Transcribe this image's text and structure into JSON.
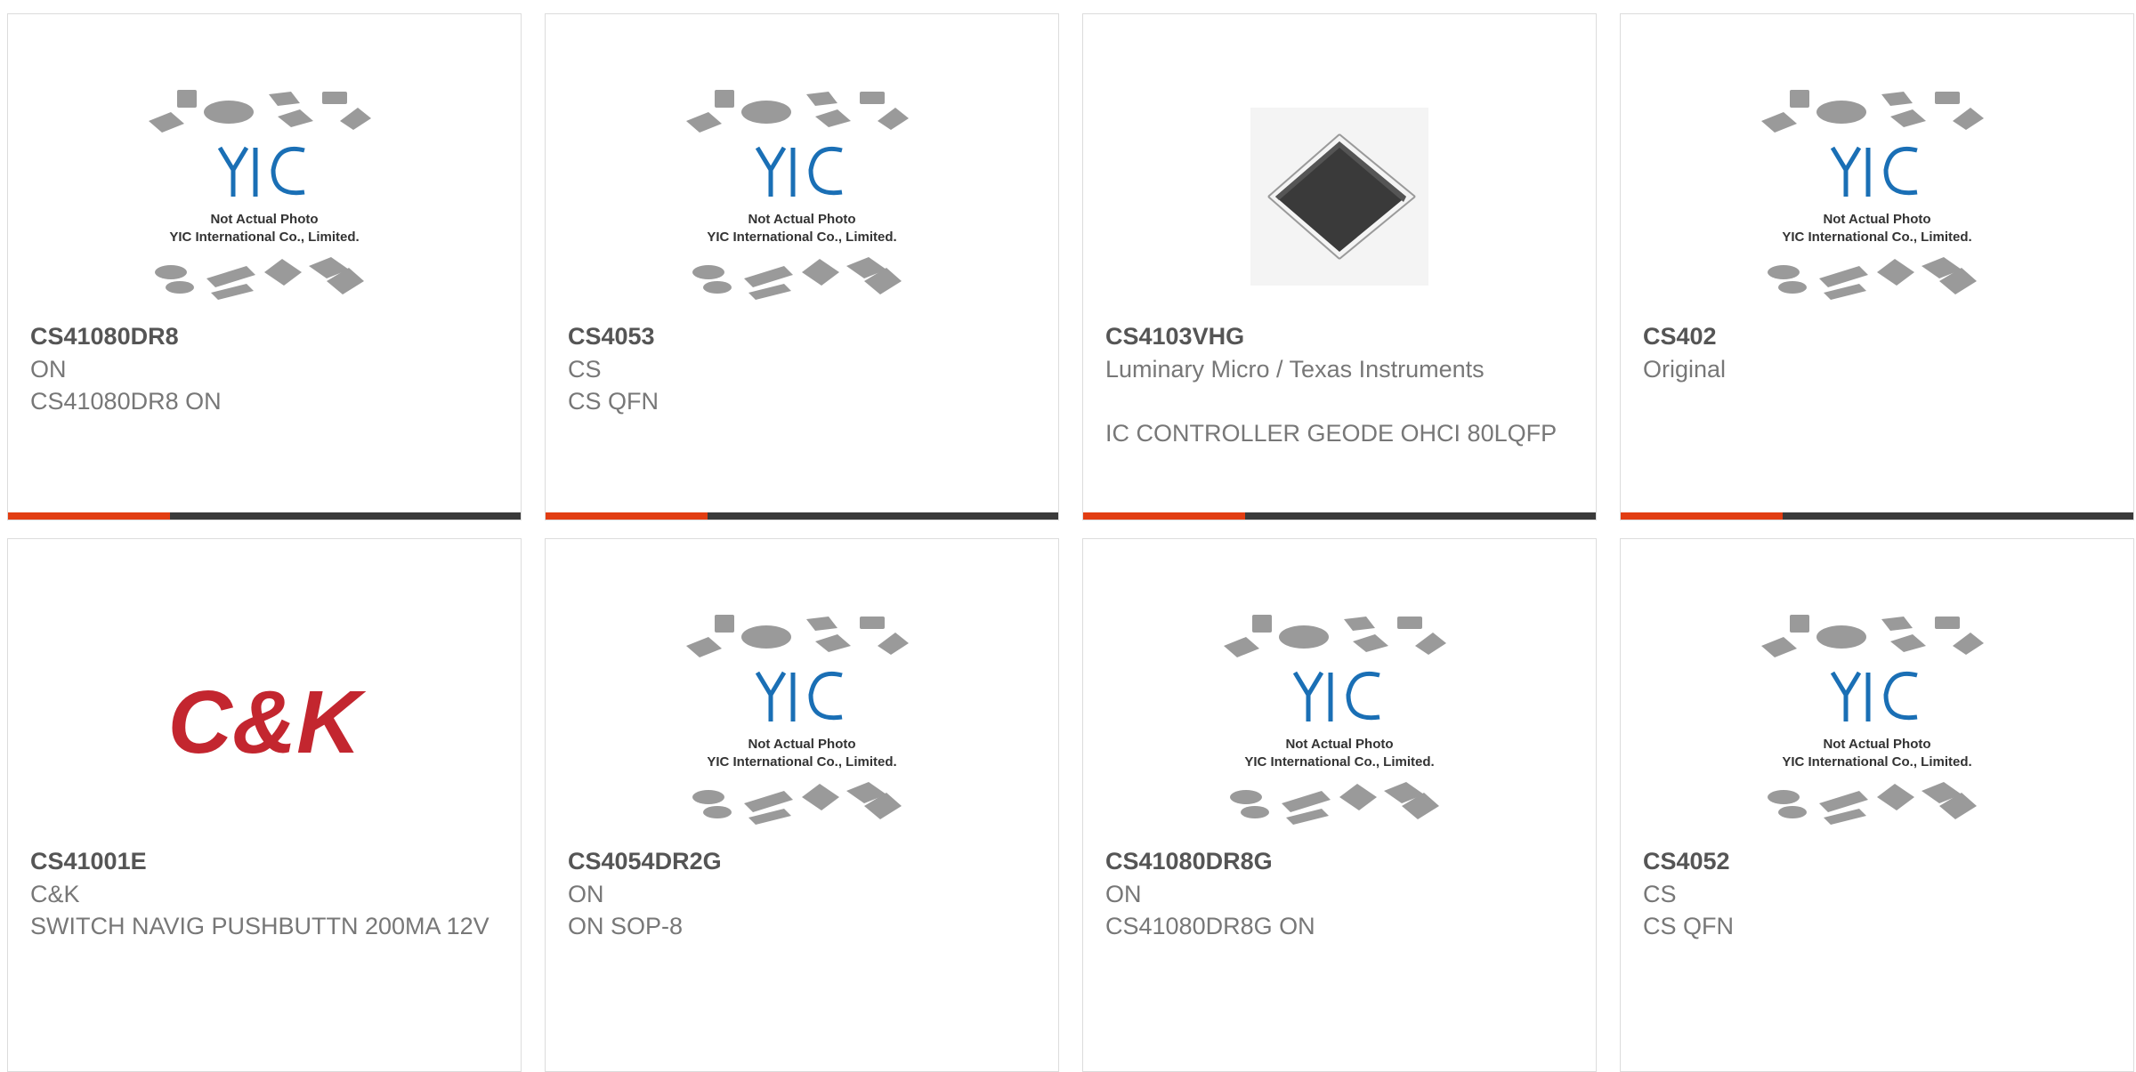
{
  "products": [
    {
      "part": "CS41080DR8",
      "maker": "ON",
      "desc": "CS41080DR8 ON",
      "image": "placeholder"
    },
    {
      "part": "CS4053",
      "maker": "CS",
      "desc": "CS QFN",
      "image": "placeholder"
    },
    {
      "part": "CS4103VHG",
      "maker": "Luminary Micro / Texas Instruments",
      "desc": "IC CONTROLLER GEODE OHCI 80LQFP",
      "image": "chip-qfp"
    },
    {
      "part": "CS402",
      "maker": "Original",
      "desc": "",
      "image": "placeholder"
    },
    {
      "part": "CS41001E",
      "maker": "C&K",
      "desc": "SWITCH NAVIG PUSHBUTTN 200MA 12V",
      "image": "ck-logo"
    },
    {
      "part": "CS4054DR2G",
      "maker": "ON",
      "desc": "ON SOP-8",
      "image": "placeholder"
    },
    {
      "part": "CS41080DR8G",
      "maker": "ON",
      "desc": "CS41080DR8G ON",
      "image": "placeholder"
    },
    {
      "part": "CS4052",
      "maker": "CS",
      "desc": "CS QFN",
      "image": "placeholder"
    }
  ],
  "placeholder": {
    "brand": "YIC",
    "line1": "Not Actual Photo",
    "line2": "YIC International Co., Limited."
  },
  "ck_logo": "C&K",
  "colors": {
    "accent": "#e23d12",
    "bar": "#3a3a3a",
    "yic_blue": "#1a6fb5",
    "ck_red": "#c3262f"
  }
}
